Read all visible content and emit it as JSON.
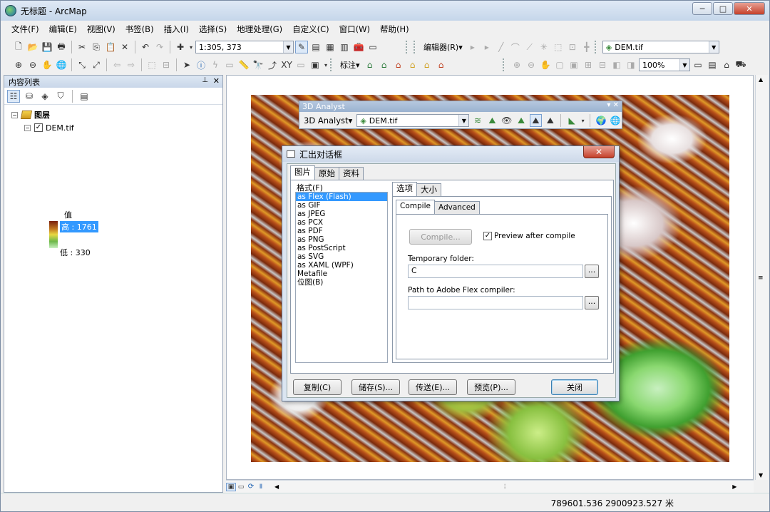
{
  "window": {
    "title": "无标题 - ArcMap",
    "buttons": {
      "minimize": "─",
      "maximize": "□",
      "close": "✕"
    }
  },
  "menu": [
    "文件(F)",
    "编辑(E)",
    "视图(V)",
    "书签(B)",
    "插入(I)",
    "选择(S)",
    "地理处理(G)",
    "自定义(C)",
    "窗口(W)",
    "帮助(H)"
  ],
  "toolbar": {
    "scale": "1:305, 373",
    "editor_label": "编辑器(R)▾",
    "layer_combo": "DEM.tif",
    "label_menu": "标注▾",
    "zoom_combo": "100%"
  },
  "toc": {
    "title": "内容列表",
    "root_label": "图层",
    "layer_name": "DEM.tif",
    "value_label": "值",
    "high_label": "高 : 1761",
    "low_label": "低 : 330"
  },
  "analyst": {
    "title": "3D Analyst",
    "menu_label": "3D Analyst▾",
    "layer_combo": "DEM.tif"
  },
  "dialog": {
    "title": "汇出对话框",
    "tabs": [
      "图片",
      "原始",
      "资料"
    ],
    "format_label": "格式(F)",
    "formats": [
      "as Flex (Flash)",
      "as GIF",
      "as JPEG",
      "as PCX",
      "as PDF",
      "as PNG",
      "as PostScript",
      "as SVG",
      "as XAML (WPF)",
      "Metafile",
      "位图(B)"
    ],
    "option_tabs": [
      "选项",
      "大小"
    ],
    "sub_tabs": [
      "Compile",
      "Advanced"
    ],
    "compile_button": "Compile...",
    "preview_checkbox": "Preview after compile",
    "preview_checked": true,
    "temp_folder_label": "Temporary folder:",
    "temp_folder_value": "C",
    "flex_path_label": "Path to Adobe Flex compiler:",
    "flex_path_value": "",
    "browse_label": "...",
    "buttons": {
      "copy": "复制(C)",
      "save": "储存(S)...",
      "send": "传送(E)...",
      "preview": "预览(P)...",
      "close": "关闭"
    }
  },
  "status": {
    "coordinates": "789601.536  2900923.527 米"
  }
}
